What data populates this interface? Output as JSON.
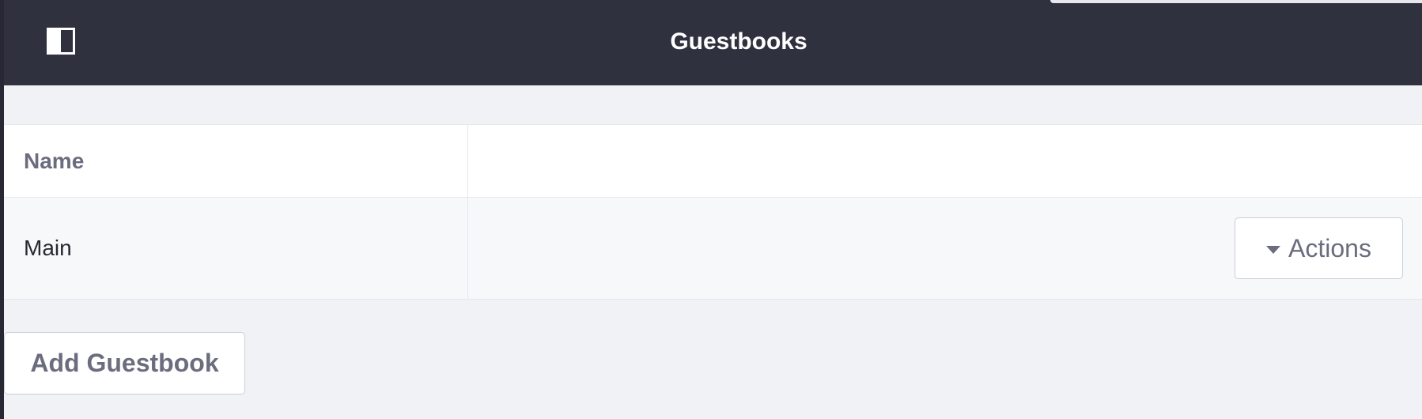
{
  "header": {
    "title": "Guestbooks",
    "toggle_icon": "sidebar-toggle-icon",
    "background_color": "#30313f"
  },
  "table": {
    "columns": [
      "Name"
    ],
    "rows": [
      {
        "name": "Main",
        "action_label": "Actions",
        "action_icon": "caret-down-icon"
      }
    ]
  },
  "footer": {
    "add_label": "Add Guestbook"
  }
}
